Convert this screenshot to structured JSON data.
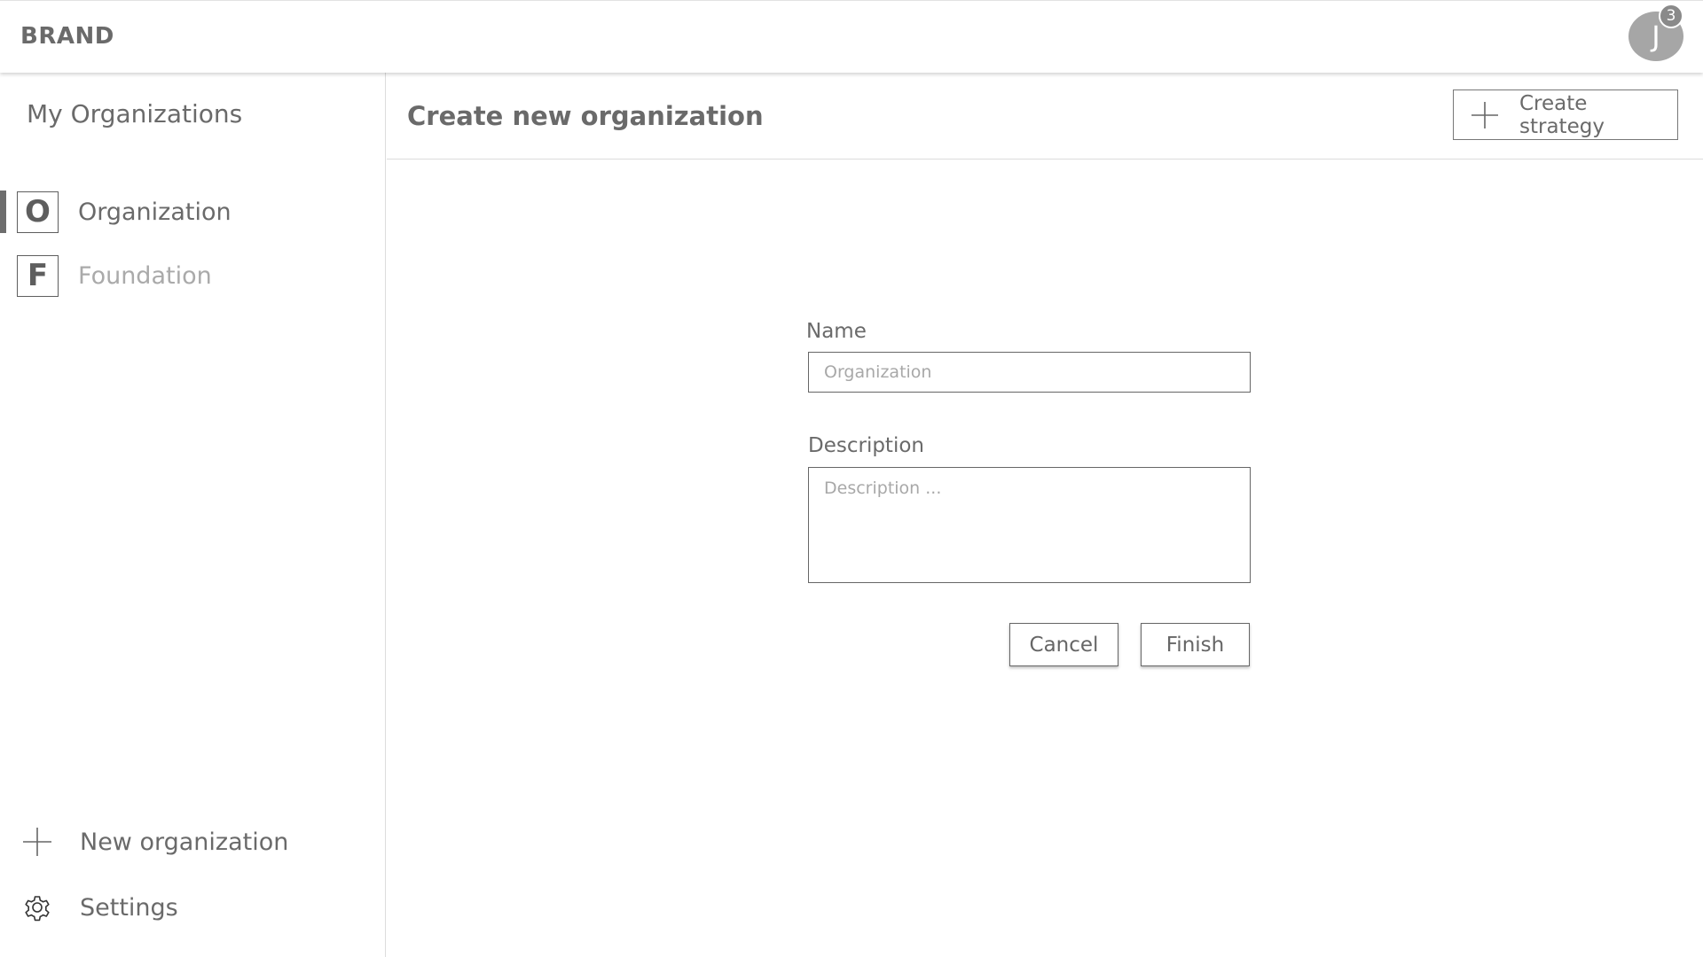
{
  "brand": "BRAND",
  "user": {
    "initial": "J",
    "notification_count": "3"
  },
  "sidebar": {
    "title": "My Organizations",
    "organizations": [
      {
        "letter": "O",
        "name": "Organization",
        "active": true
      },
      {
        "letter": "F",
        "name": "Foundation",
        "active": false
      }
    ],
    "new_organization_label": "New organization",
    "settings_label": "Settings"
  },
  "main": {
    "title": "Create new organization",
    "create_strategy_label": "Create strategy"
  },
  "form": {
    "name_label": "Name",
    "name_placeholder": "Organization",
    "name_value": "",
    "description_label": "Description",
    "description_placeholder": "Description ...",
    "description_value": "",
    "cancel_label": "Cancel",
    "finish_label": "Finish"
  },
  "icons": {
    "plus": "plus-icon",
    "settings": "gear-icon"
  }
}
